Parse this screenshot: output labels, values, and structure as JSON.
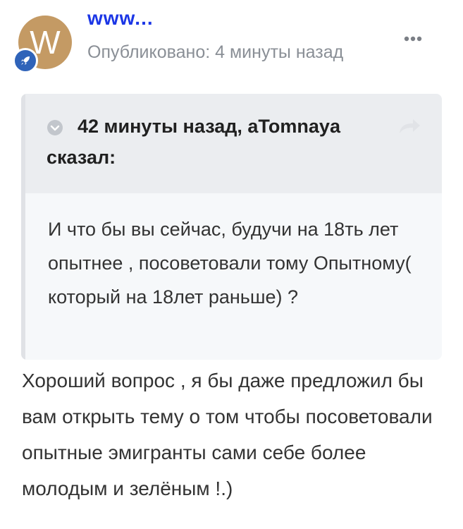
{
  "author": {
    "name": "www...",
    "avatar_letter": "W",
    "avatar_color": "#c49a64",
    "rank_icon": "rocket-icon",
    "rank_color": "#2f63b9"
  },
  "post": {
    "published": "Опубликовано: 4 минуты назад"
  },
  "quote": {
    "header": "42 минуты назад, aTomnaya сказал:",
    "collapse_icon": "chevron-circle-icon",
    "share_icon": "share-arrow-icon",
    "text": "И что бы вы сейчас, будучи на 18ть лет опытнее , посоветовали тому Опытному( который на 18лет раньше) ?"
  },
  "reply": {
    "text": "Хороший вопрос , я бы даже предложил бы вам открыть тему о том чтобы посоветовали опытные эмигранты сами себе более молодым и зелёным !.)"
  },
  "colors": {
    "author_link": "#1b36e6",
    "muted": "#8a8f96",
    "quote_header_bg": "#ebedf0",
    "quote_body_bg": "#f6f8fa"
  }
}
